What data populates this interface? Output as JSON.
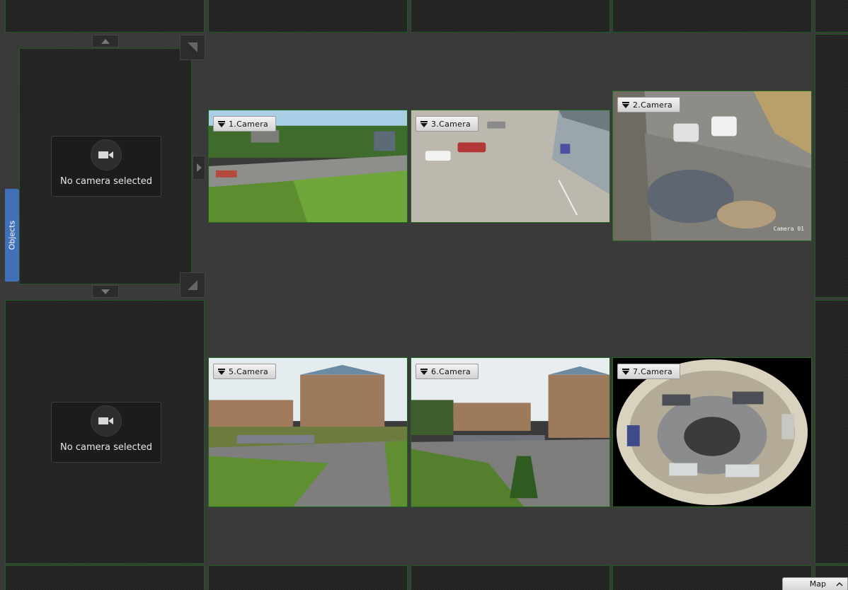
{
  "sidebar": {
    "objects_tab_label": "Objects"
  },
  "empty_slots": [
    {
      "message": "No camera selected"
    },
    {
      "message": "No camera selected"
    }
  ],
  "cameras": [
    {
      "label": "1.Camera"
    },
    {
      "label": "3.Camera"
    },
    {
      "label": "2.Camera",
      "osd_text": "Camera 01"
    },
    {
      "label": "5.Camera"
    },
    {
      "label": "6.Camera"
    },
    {
      "label": "7.Camera"
    }
  ],
  "footer": {
    "map_tab_label": "Map"
  },
  "colors": {
    "cell_border": "#1f5a1f",
    "objects_tab": "#3f70b8",
    "background": "#3a3a3a"
  },
  "icons": {
    "label_dropdown": "chevron-down-icon",
    "empty_slot": "video-camera-icon",
    "map_toggle": "chevron-up-icon"
  }
}
